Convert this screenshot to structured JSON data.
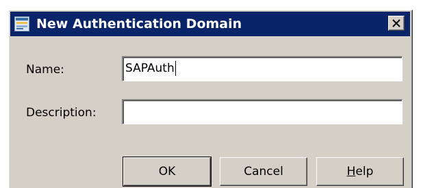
{
  "window": {
    "title": "New Authentication Domain",
    "icon": "app-icon",
    "title_bar_color": "#0a246a",
    "close_label": "close-icon"
  },
  "form": {
    "name_label": "Name:",
    "name_value": "SAPAuth",
    "description_label": "Description:",
    "description_value": ""
  },
  "buttons": {
    "ok_label": "OK",
    "cancel_label": "Cancel",
    "help_mnemonic": "H",
    "help_rest": "elp"
  }
}
